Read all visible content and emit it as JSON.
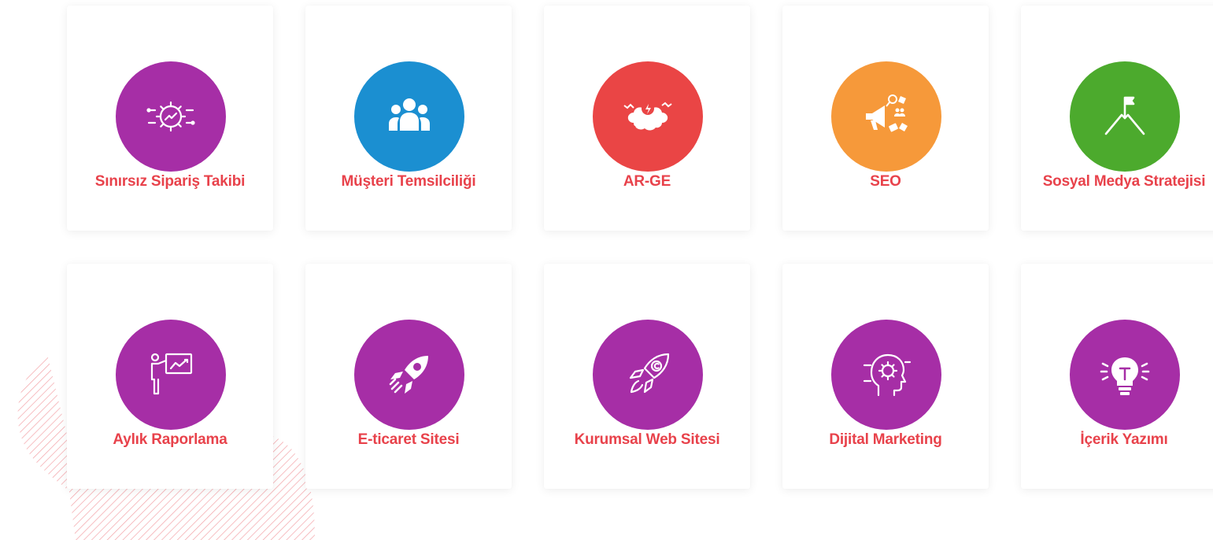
{
  "colors": {
    "label": "#e8424b",
    "purple": "#a62ea6",
    "blue": "#1b8fd1",
    "red": "#ea4545",
    "orange": "#f6993a",
    "green": "#4caa2d",
    "hatch": "#f3a3a8"
  },
  "services": [
    {
      "label": "Sınırsız Sipariş Takibi",
      "icon": "gear-chart-icon",
      "color": "#a62ea6"
    },
    {
      "label": "Müşteri Temsilciliği",
      "icon": "users-group-icon",
      "color": "#1b8fd1"
    },
    {
      "label": "AR-GE",
      "icon": "brain-lightbulb-icon",
      "color": "#ea4545"
    },
    {
      "label": "SEO",
      "icon": "megaphone-marketing-icon",
      "color": "#f6993a"
    },
    {
      "label": "Sosyal Medya Stratejisi",
      "icon": "mountain-flag-icon",
      "color": "#4caa2d"
    },
    {
      "label": "Aylık Raporlama",
      "icon": "presentation-board-icon",
      "color": "#a62ea6"
    },
    {
      "label": "E-ticaret Sitesi",
      "icon": "rocket-icon",
      "color": "#a62ea6"
    },
    {
      "label": "Kurumsal Web Sitesi",
      "icon": "rocket-copyright-icon",
      "color": "#a62ea6"
    },
    {
      "label": "Dijital Marketing",
      "icon": "head-gear-icon",
      "color": "#a62ea6"
    },
    {
      "label": "İçerik Yazımı",
      "icon": "lightbulb-idea-icon",
      "color": "#a62ea6"
    }
  ]
}
